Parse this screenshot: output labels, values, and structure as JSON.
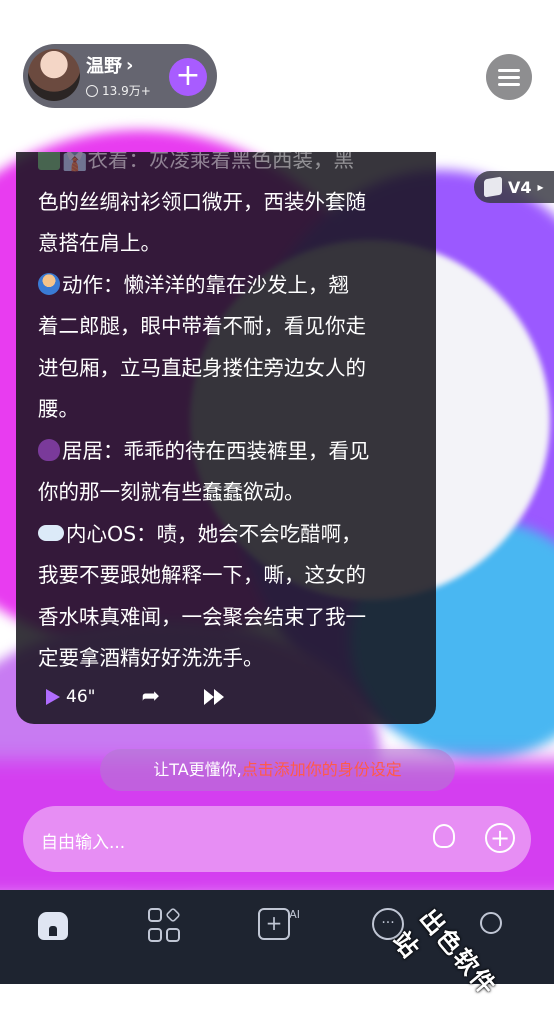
{
  "profile": {
    "name": "温野",
    "chevron": "›",
    "stat": "13.9万+",
    "add_symbol": "+"
  },
  "version": {
    "label": "V4",
    "arrow": "▸"
  },
  "message": {
    "lines": [
      "👔衣着：灰凌乘着黑色西装，黑",
      "色的丝绸衬衫领口微开，西装外套随",
      "意搭在肩上。",
      "动作：懒洋洋的靠在沙发上，翘",
      "着二郎腿，眼中带着不耐，看见你走",
      "进包厢，立马直起身搂住旁边女人的",
      "腰。",
      "居居：乖乖的待在西装裤里，看见",
      "你的那一刻就有些蠢蠢欲动。",
      "内心OS：啧，她会不会吃醋啊，",
      "我要不要跟她解释一下，嘶，这女的",
      "香水味真难闻，一会聚会结束了我一",
      "定要拿酒精好好洗洗手。"
    ],
    "duration": "46\"",
    "share_symbol": "➦"
  },
  "hint": {
    "prefix": "让TA更懂你,",
    "link": "点击添加你的身份设定"
  },
  "input": {
    "placeholder": "自由输入...",
    "plus_symbol": "+"
  },
  "tabbar": {
    "ai_symbol": "+",
    "ai_sup": "AI",
    "chat_symbol": "···"
  },
  "watermark": "出色软件站",
  "colors": {
    "accent": "#a85cff",
    "link": "#ff5a4a",
    "tabbar_bg": "#1e2430"
  }
}
